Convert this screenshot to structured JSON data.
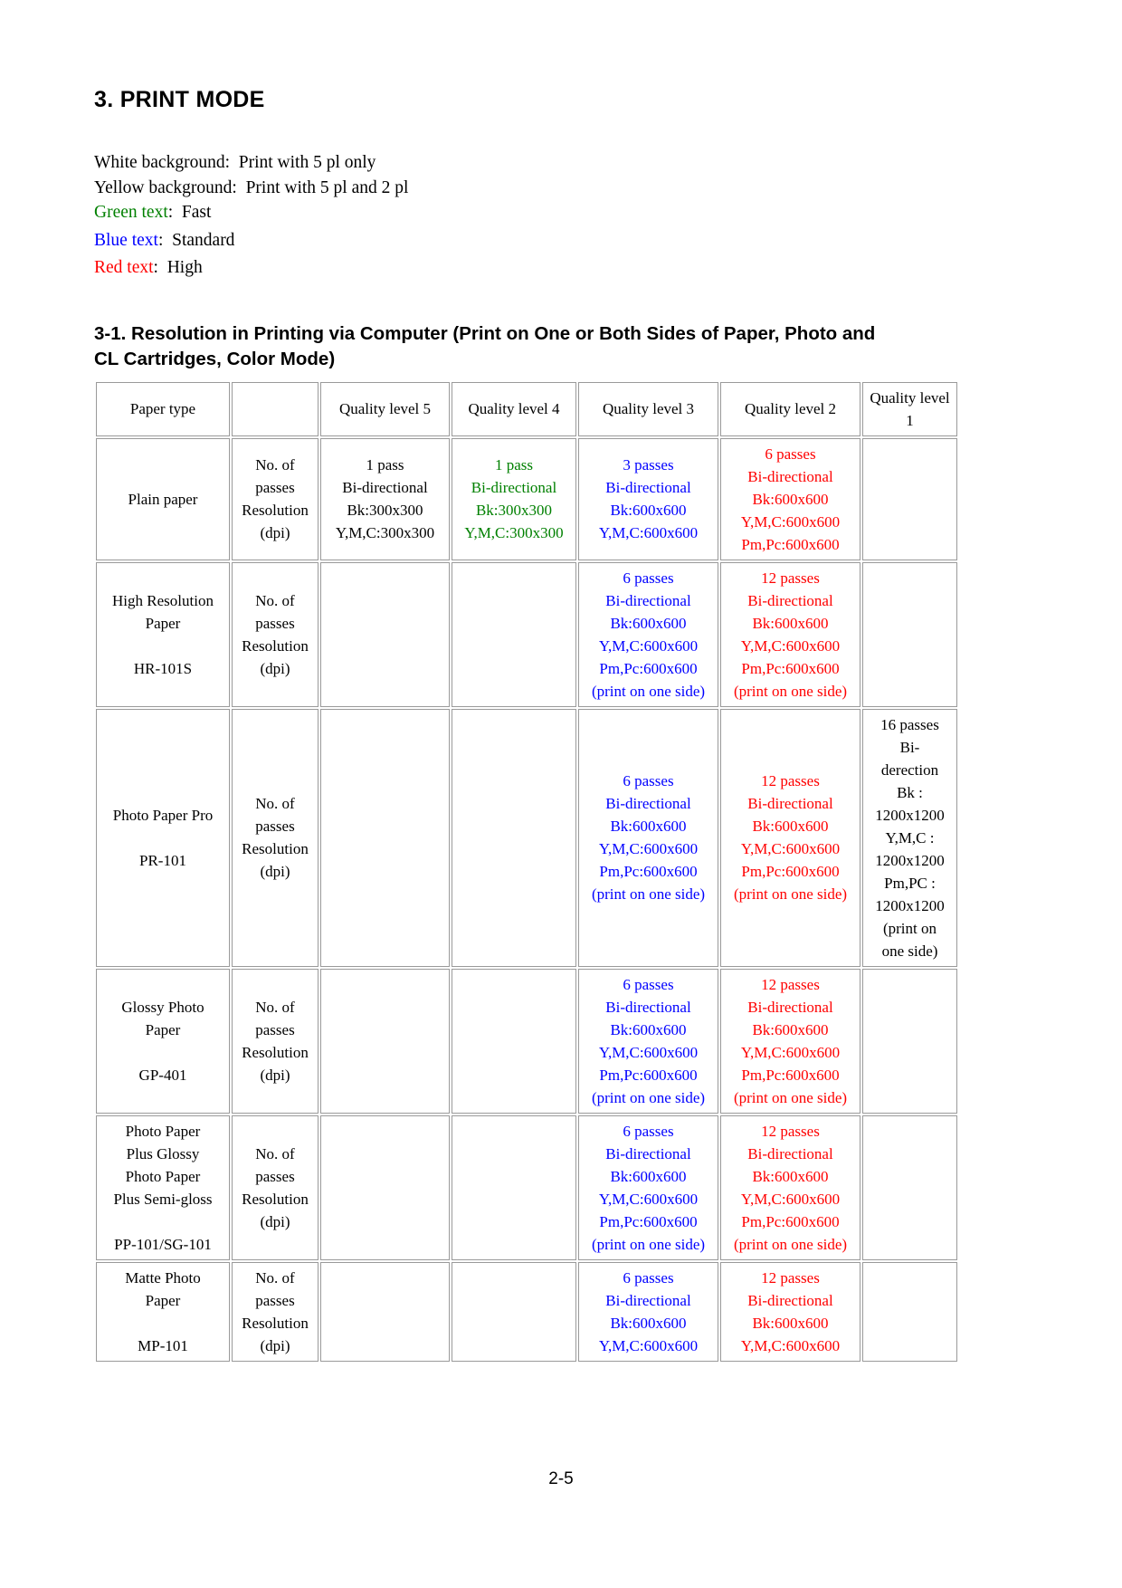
{
  "document": {
    "section_number_title": "3.  PRINT MODE",
    "page_footer": "2-5"
  },
  "legend": {
    "lines": [
      {
        "label": "White background:",
        "label_color": "black",
        "value": "  Print with 5 pl only"
      },
      {
        "label": "Yellow background:",
        "label_color": "black",
        "value": "  Print with 5 pl and 2 pl"
      },
      {
        "label": "Green text",
        "label_color": "green",
        "value": ":  Fast"
      },
      {
        "label": "Blue text",
        "label_color": "blue",
        "value": ":  Standard"
      },
      {
        "label": "Red text",
        "label_color": "red",
        "value": ":  High"
      }
    ]
  },
  "subsection": {
    "title": "3-1.  Resolution in Printing via Computer (Print on One or Both Sides of Paper, Photo and CL Cartridges,  Color Mode)"
  },
  "table": {
    "headers": [
      "Paper type",
      "",
      "Quality level 5",
      "Quality level 4",
      "Quality level 3",
      "Quality level 2",
      "Quality level 1"
    ],
    "rows": [
      {
        "paper": [
          "Plain paper"
        ],
        "kind": [
          "No. of",
          "passes",
          "Resolution",
          "(dpi)"
        ],
        "q5": {
          "color": "black",
          "shaded": false,
          "lines": [
            "1 pass",
            "Bi-directional",
            "Bk:300x300",
            "Y,M,C:300x300"
          ]
        },
        "q4": {
          "color": "green",
          "shaded": false,
          "lines": [
            "1 pass",
            "Bi-directional",
            "Bk:300x300",
            "Y,M,C:300x300"
          ]
        },
        "q3": {
          "color": "blue",
          "shaded": false,
          "lines": [
            "3 passes",
            "Bi-directional",
            "Bk:600x600",
            "Y,M,C:600x600"
          ]
        },
        "q2": {
          "color": "red",
          "shaded": false,
          "lines": [
            "6 passes",
            "Bi-directional",
            "Bk:600x600",
            "Y,M,C:600x600",
            "Pm,Pc:600x600"
          ]
        },
        "q1": {
          "color": "black",
          "shaded": false,
          "lines": []
        }
      },
      {
        "paper": [
          "High Resolution",
          "Paper",
          "",
          "HR-101S"
        ],
        "kind": [
          "No. of",
          "passes",
          "Resolution",
          "(dpi)"
        ],
        "q5": {
          "color": "black",
          "shaded": false,
          "lines": []
        },
        "q4": {
          "color": "black",
          "shaded": false,
          "lines": []
        },
        "q3": {
          "color": "blue",
          "shaded": false,
          "lines": [
            "6 passes",
            "Bi-directional",
            "Bk:600x600",
            "Y,M,C:600x600",
            "Pm,Pc:600x600",
            "(print on one side)"
          ]
        },
        "q2": {
          "color": "red",
          "shaded": true,
          "lines": [
            "12 passes",
            "Bi-directional",
            "Bk:600x600",
            "Y,M,C:600x600",
            "Pm,Pc:600x600",
            "(print on one side)"
          ]
        },
        "q1": {
          "color": "black",
          "shaded": false,
          "lines": []
        }
      },
      {
        "paper": [
          "Photo Paper Pro",
          "",
          "PR-101"
        ],
        "kind": [
          "No. of",
          "passes",
          "Resolution",
          "(dpi)"
        ],
        "q5": {
          "color": "black",
          "shaded": false,
          "lines": []
        },
        "q4": {
          "color": "black",
          "shaded": false,
          "lines": []
        },
        "q3": {
          "color": "blue",
          "shaded": false,
          "lines": [
            "6 passes",
            "Bi-directional",
            "Bk:600x600",
            "Y,M,C:600x600",
            "Pm,Pc:600x600",
            "(print on one side)"
          ]
        },
        "q2": {
          "color": "red",
          "shaded": true,
          "lines": [
            "12 passes",
            "Bi-directional",
            "Bk:600x600",
            "Y,M,C:600x600",
            "Pm,Pc:600x600",
            "(print on one side)"
          ]
        },
        "q1": {
          "color": "black",
          "shaded": true,
          "lines": [
            "16 passes",
            "Bi-",
            "derection",
            "Bk :",
            "1200x1200",
            "Y,M,C :",
            "1200x1200",
            "Pm,PC :",
            "1200x1200",
            "(print on",
            "one side)"
          ]
        }
      },
      {
        "paper": [
          "Glossy Photo",
          "Paper",
          "",
          "GP-401"
        ],
        "kind": [
          "No. of",
          "passes",
          "Resolution",
          "(dpi)"
        ],
        "q5": {
          "color": "black",
          "shaded": false,
          "lines": []
        },
        "q4": {
          "color": "black",
          "shaded": false,
          "lines": []
        },
        "q3": {
          "color": "blue",
          "shaded": false,
          "lines": [
            "6 passes",
            "Bi-directional",
            "Bk:600x600",
            "Y,M,C:600x600",
            "Pm,Pc:600x600",
            "(print on one side)"
          ]
        },
        "q2": {
          "color": "red",
          "shaded": true,
          "lines": [
            "12 passes",
            "Bi-directional",
            "Bk:600x600",
            "Y,M,C:600x600",
            "Pm,Pc:600x600",
            "(print on one side)"
          ]
        },
        "q1": {
          "color": "black",
          "shaded": false,
          "lines": []
        }
      },
      {
        "paper": [
          "Photo Paper",
          "Plus Glossy",
          "Photo Paper",
          "Plus Semi-gloss",
          "",
          "PP-101/SG-101"
        ],
        "kind": [
          "No. of",
          "passes",
          "Resolution",
          "(dpi)"
        ],
        "q5": {
          "color": "black",
          "shaded": false,
          "lines": []
        },
        "q4": {
          "color": "black",
          "shaded": false,
          "lines": []
        },
        "q3": {
          "color": "blue",
          "shaded": false,
          "lines": [
            "6 passes",
            "Bi-directional",
            "Bk:600x600",
            "Y,M,C:600x600",
            "Pm,Pc:600x600",
            "(print on one side)"
          ]
        },
        "q2": {
          "color": "red",
          "shaded": true,
          "lines": [
            "12 passes",
            "Bi-directional",
            "Bk:600x600",
            "Y,M,C:600x600",
            "Pm,Pc:600x600",
            "(print on one side)"
          ]
        },
        "q1": {
          "color": "black",
          "shaded": false,
          "lines": []
        }
      },
      {
        "paper": [
          "Matte Photo",
          "Paper",
          "",
          "MP-101"
        ],
        "kind": [
          "No. of",
          "passes",
          "Resolution",
          "(dpi)"
        ],
        "q5": {
          "color": "black",
          "shaded": false,
          "lines": []
        },
        "q4": {
          "color": "black",
          "shaded": false,
          "lines": []
        },
        "q3": {
          "color": "blue",
          "shaded": false,
          "lines": [
            "6 passes",
            "Bi-directional",
            "Bk:600x600",
            "Y,M,C:600x600"
          ]
        },
        "q2": {
          "color": "red",
          "shaded": true,
          "lines": [
            "12 passes",
            "Bi-directional",
            "Bk:600x600",
            "Y,M,C:600x600"
          ]
        },
        "q1": {
          "color": "black",
          "shaded": false,
          "lines": []
        }
      }
    ]
  },
  "colors": {
    "green": "#008000",
    "blue": "#0000ff",
    "red": "#ff0000",
    "black": "#000000",
    "shaded_background": "#c0c0c0",
    "cell_border": "#9a9a9a"
  }
}
